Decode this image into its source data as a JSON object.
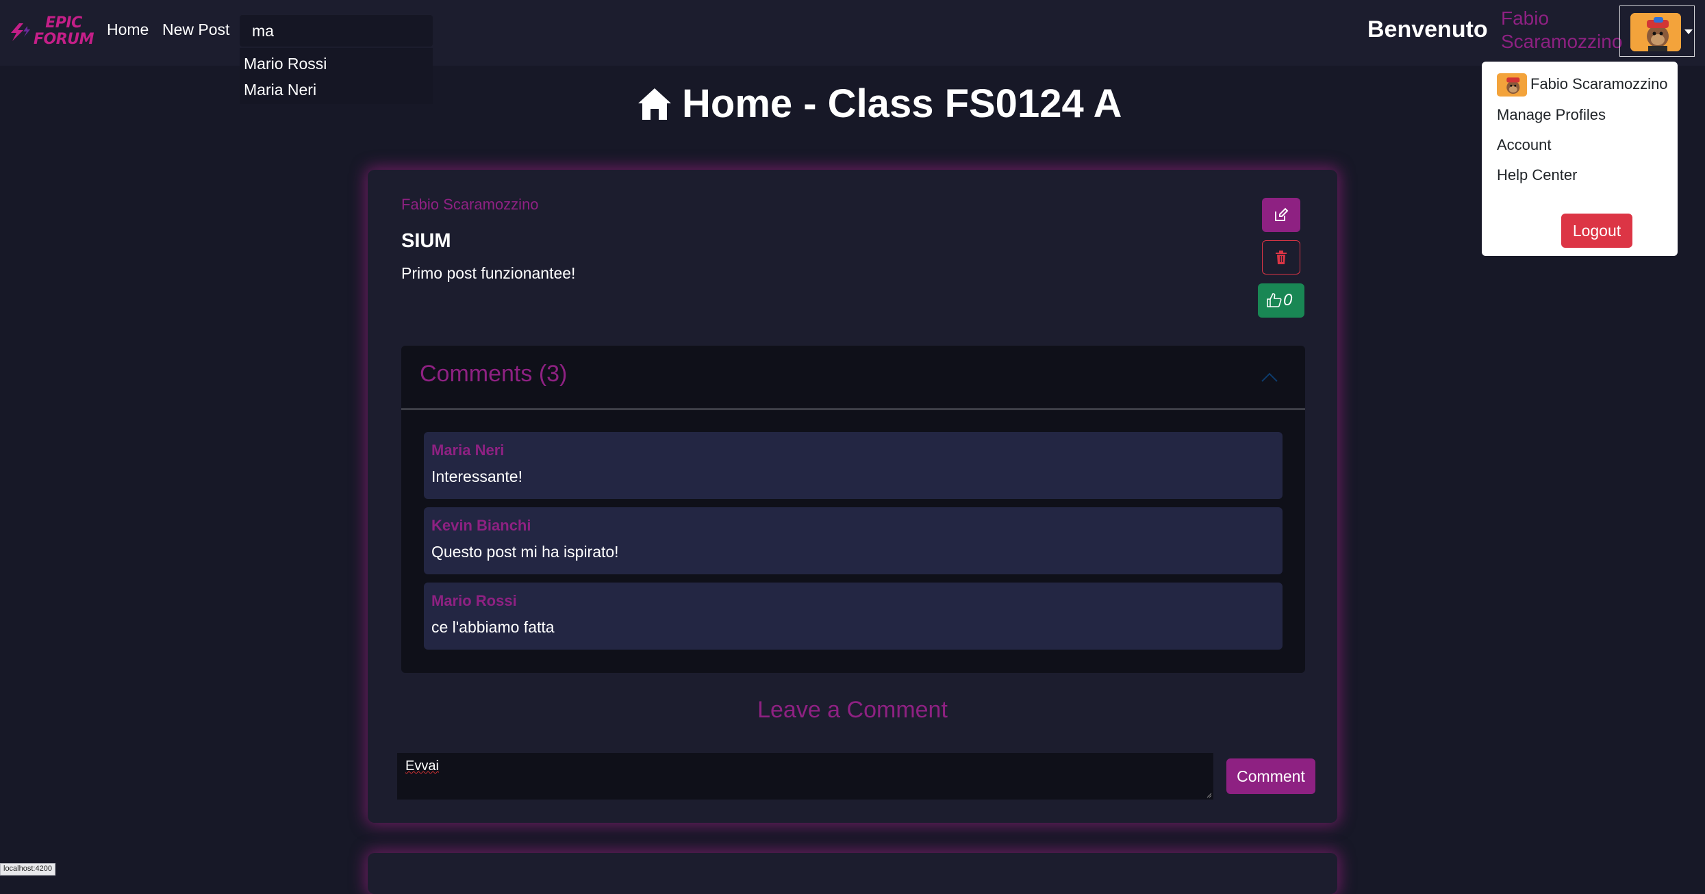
{
  "navbar": {
    "brand_text": "EPIC FORUM",
    "links": [
      {
        "label": "Home"
      },
      {
        "label": "New Post"
      }
    ],
    "search": {
      "value": "ma",
      "suggestions": [
        "Mario Rossi",
        "Maria Neri"
      ]
    },
    "welcome": "Benvenuto",
    "username": "Fabio Scaramozzino"
  },
  "user_menu": {
    "name": "Fabio Scaramozzino",
    "items": [
      {
        "label": "Manage Profiles"
      },
      {
        "label": "Account"
      },
      {
        "label": "Help Center"
      }
    ],
    "logout_label": "Logout"
  },
  "page": {
    "title": "Home - Class FS0124 A"
  },
  "post": {
    "author": "Fabio Scaramozzino",
    "title": "SIUM",
    "body": "Primo post funzionantee!",
    "likes": "0",
    "comments_header": "Comments (3)",
    "comments": [
      {
        "author": "Maria Neri",
        "text": "Interessante!"
      },
      {
        "author": "Kevin Bianchi",
        "text": "Questo post mi ha ispirato!"
      },
      {
        "author": "Mario Rossi",
        "text": "ce l'abbiamo fatta"
      }
    ],
    "leave_comment_title": "Leave a Comment",
    "comment_input_value": "Evvai",
    "comment_button_label": "Comment"
  },
  "status_bar": {
    "url": "localhost:4200"
  },
  "colors": {
    "accent": "#8e2182",
    "brand": "#c41f88",
    "danger": "#dc3545",
    "success": "#198754",
    "background": "#171827",
    "navbar": "#1c1d2e",
    "comment_bg": "#232643"
  }
}
